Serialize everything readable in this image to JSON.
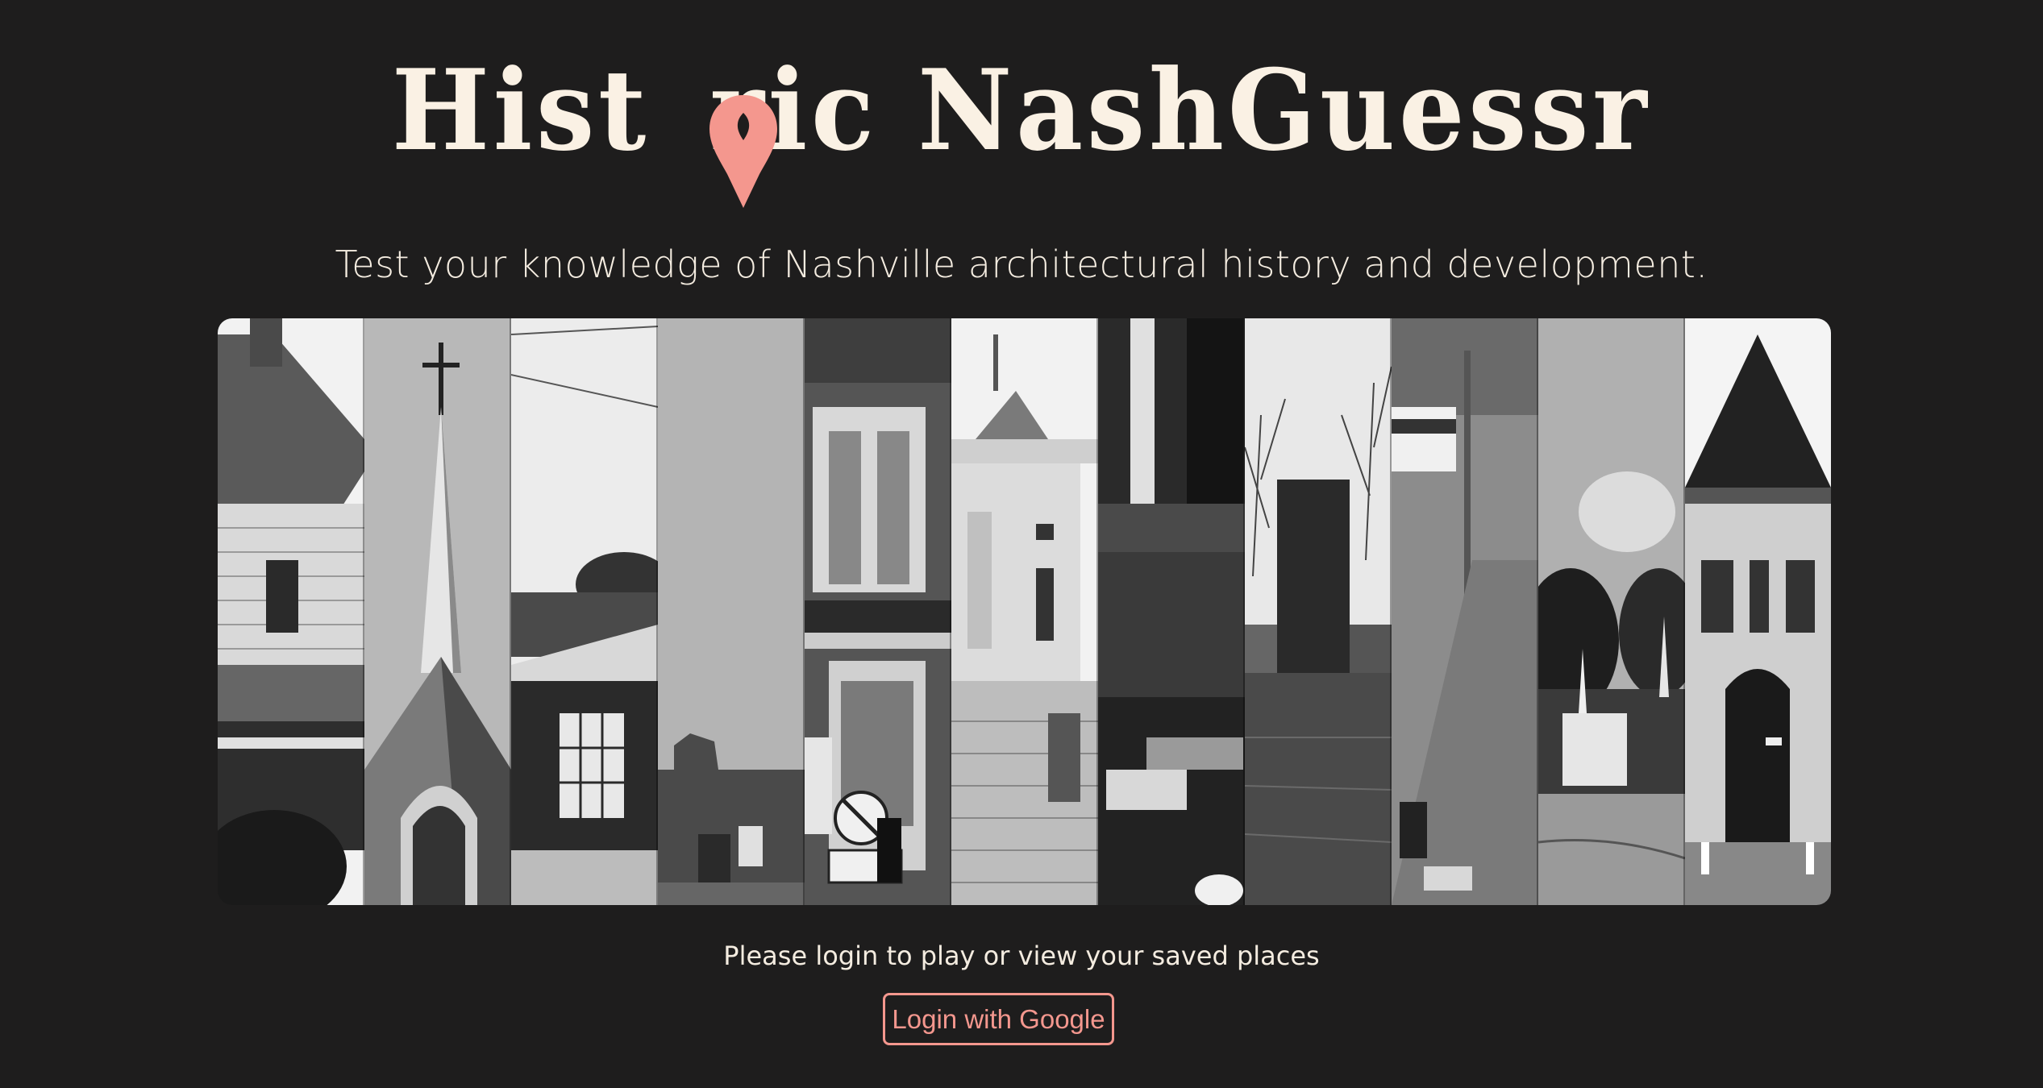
{
  "header": {
    "title_part1": "Hist",
    "title_part2": "ric NashGuessr",
    "pin_icon": "map-pin-icon",
    "pin_color": "#f4978e",
    "title_color": "#faf1e4"
  },
  "tagline": "Test your knowledge of Nashville architectural history and development.",
  "gallery": {
    "strip_count": 11,
    "strips": [
      "victorian-house-photo",
      "church-steeple-photo",
      "brick-building-photo",
      "ruined-wall-photo",
      "brick-facade-no-right-turn-photo",
      "rotunda-building-photo",
      "street-storefront-photo",
      "flooded-street-photo",
      "marlboro-sign-street-photo",
      "cemetery-obelisk-photo",
      "gothic-tower-house-photo"
    ]
  },
  "login": {
    "prompt": "Please login to play or view your saved places",
    "button_label": "Login with Google",
    "accent_color": "#f4978e"
  },
  "colors": {
    "background": "#1e1d1d",
    "text": "#f4ece0"
  }
}
